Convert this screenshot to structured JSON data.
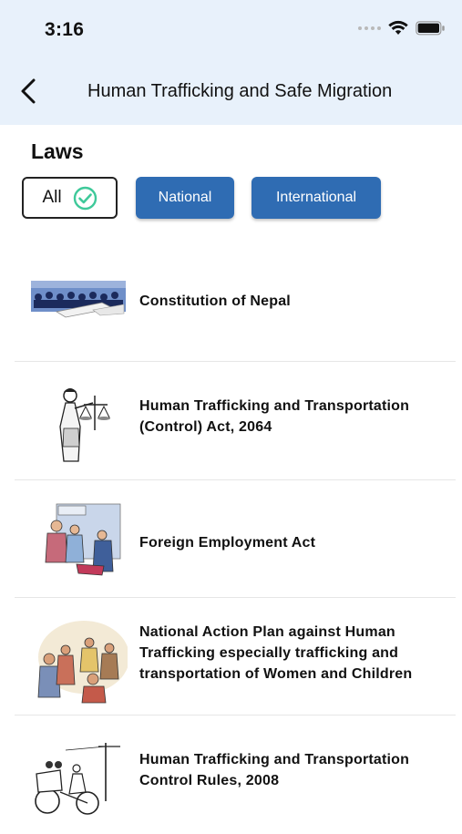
{
  "status_bar": {
    "time": "3:16"
  },
  "header": {
    "title": "Human Trafficking and Safe Migration"
  },
  "section": {
    "title": "Laws"
  },
  "filters": [
    {
      "label": "All",
      "selected": true
    },
    {
      "label": "National",
      "selected": false
    },
    {
      "label": "International",
      "selected": false
    }
  ],
  "laws": [
    {
      "title": "Constitution of Nepal",
      "icon": "assembly-illustration"
    },
    {
      "title": "Human Trafficking and Transportation (Control) Act, 2064",
      "icon": "justice-scales-illustration"
    },
    {
      "title": "Foreign Employment Act",
      "icon": "migrant-workers-illustration"
    },
    {
      "title": "National Action Plan against Human Trafficking especially trafficking and transportation of Women and Children",
      "icon": "community-meeting-illustration"
    },
    {
      "title": "Human Trafficking and Transportation Control Rules, 2008",
      "icon": "rickshaw-illustration"
    }
  ],
  "colors": {
    "header_bg": "#e8f1fb",
    "chip_blue": "#2f6cb3",
    "check_green": "#3fc99a"
  }
}
